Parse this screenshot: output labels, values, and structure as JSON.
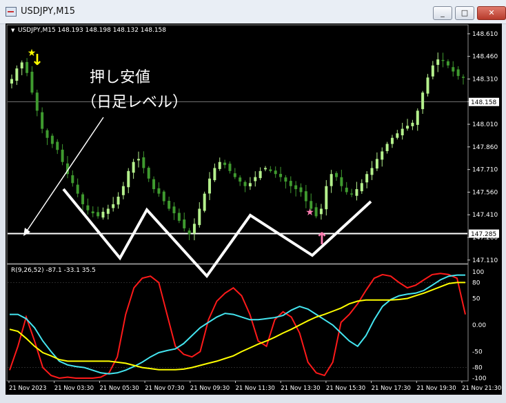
{
  "window": {
    "title": "USDJPY,M15",
    "icon": "chart-window-icon",
    "buttons": {
      "minimize": "_",
      "maximize": "□",
      "close": "✕"
    }
  },
  "colors": {
    "background": "#000000",
    "bull_candle": "#b4f08c",
    "bear_candle": "#3f9a2f",
    "bid_line": "#ffffff",
    "support_line": "#ffffff",
    "rci_short": "#ff1a1a",
    "rci_mid": "#44e5f0",
    "rci_long": "#ffff00",
    "sell_arrow": "#ffff00",
    "buy_arrow": "#ff7fb3",
    "zigzag": "#ffffff"
  },
  "chart_data": [
    {
      "type": "candlestick",
      "symbol_header": "USDJPY,M15  148.193 148.198 148.132 148.158",
      "ylim": [
        147.1,
        148.66
      ],
      "y_ticks": [
        "148.610",
        "148.460",
        "148.310",
        "148.160",
        "148.010",
        "147.860",
        "147.710",
        "147.560",
        "147.410",
        "147.260",
        "147.110"
      ],
      "current_price": "148.158",
      "support_price": "147.285",
      "x_ticks": [
        "21 Nov 2023",
        "21 Nov 03:30",
        "21 Nov 05:30",
        "21 Nov 07:30",
        "21 Nov 09:30",
        "21 Nov 11:30",
        "21 Nov 13:30",
        "21 Nov 15:30",
        "21 Nov 17:30",
        "21 Nov 19:30",
        "21 Nov 21:30"
      ],
      "annotation": [
        "押し安値",
        "（日足レベル）"
      ],
      "close_path": [
        148.31,
        148.38,
        148.42,
        148.35,
        148.22,
        148.1,
        147.98,
        147.92,
        147.88,
        147.84,
        147.76,
        147.68,
        147.62,
        147.55,
        147.48,
        147.44,
        147.42,
        147.4,
        147.43,
        147.45,
        147.48,
        147.53,
        147.6,
        147.7,
        147.76,
        147.78,
        147.72,
        147.65,
        147.58,
        147.55,
        147.5,
        147.45,
        147.42,
        147.37,
        147.32,
        147.28,
        147.35,
        147.45,
        147.55,
        147.65,
        147.72,
        147.76,
        147.74,
        147.7,
        147.66,
        147.63,
        147.6,
        147.62,
        147.66,
        147.7,
        147.72,
        147.7,
        147.68,
        147.66,
        147.63,
        147.6,
        147.58,
        147.56,
        147.5,
        147.45,
        147.4,
        147.45,
        147.6,
        147.68,
        147.66,
        147.6,
        147.56,
        147.55,
        147.58,
        147.62,
        147.68,
        147.72,
        147.78,
        147.83,
        147.88,
        147.92,
        147.95,
        147.98,
        148.0,
        148.02,
        148.1,
        148.22,
        148.32,
        148.4,
        148.44,
        148.43,
        148.4,
        148.36,
        148.33,
        148.32
      ],
      "markers": [
        {
          "type": "sell-arrow",
          "index": 5,
          "label": "↓"
        },
        {
          "type": "star",
          "index": 5,
          "color": "#ffff00"
        },
        {
          "type": "buy-arrow",
          "index": 61,
          "label": "↑"
        },
        {
          "type": "star",
          "index": 59,
          "color": "#ff7fb3"
        }
      ]
    },
    {
      "type": "line",
      "indicator_label": "R(9,26,52) -87.1 -33.1 35.5",
      "ylim": [
        -100,
        100
      ],
      "y_ticks": [
        "100",
        "80",
        "50",
        "0.00",
        "-50",
        "-80",
        "-100"
      ],
      "series": [
        {
          "color": "#ff1a1a",
          "values": [
            -85,
            -40,
            15,
            -30,
            -80,
            -95,
            -100,
            -98,
            -100,
            -100,
            -100,
            -98,
            -90,
            -60,
            20,
            70,
            88,
            92,
            80,
            20,
            -40,
            -55,
            -60,
            -50,
            10,
            45,
            60,
            70,
            55,
            20,
            -30,
            -40,
            10,
            25,
            15,
            -15,
            -70,
            -90,
            -95,
            -70,
            5,
            20,
            40,
            65,
            88,
            95,
            92,
            80,
            70,
            75,
            85,
            95,
            97,
            95,
            88,
            20
          ]
        },
        {
          "color": "#44e5f0",
          "values": [
            20,
            20,
            12,
            -5,
            -30,
            -50,
            -68,
            -75,
            -78,
            -80,
            -85,
            -90,
            -92,
            -90,
            -85,
            -78,
            -70,
            -60,
            -52,
            -48,
            -45,
            -35,
            -20,
            -5,
            5,
            15,
            22,
            20,
            15,
            10,
            10,
            12,
            14,
            18,
            28,
            35,
            30,
            20,
            10,
            0,
            -15,
            -30,
            -40,
            -20,
            10,
            35,
            48,
            55,
            58,
            60,
            65,
            75,
            85,
            92,
            94,
            94
          ]
        },
        {
          "color": "#ffff00",
          "values": [
            -8,
            -12,
            -25,
            -40,
            -52,
            -58,
            -65,
            -68,
            -68,
            -68,
            -68,
            -68,
            -68,
            -70,
            -72,
            -76,
            -80,
            -82,
            -84,
            -84,
            -84,
            -83,
            -80,
            -76,
            -72,
            -68,
            -63,
            -58,
            -50,
            -43,
            -36,
            -30,
            -23,
            -15,
            -8,
            0,
            8,
            15,
            20,
            26,
            32,
            40,
            45,
            47,
            47,
            47,
            47,
            48,
            50,
            55,
            60,
            66,
            72,
            78,
            80,
            80
          ]
        }
      ]
    }
  ]
}
